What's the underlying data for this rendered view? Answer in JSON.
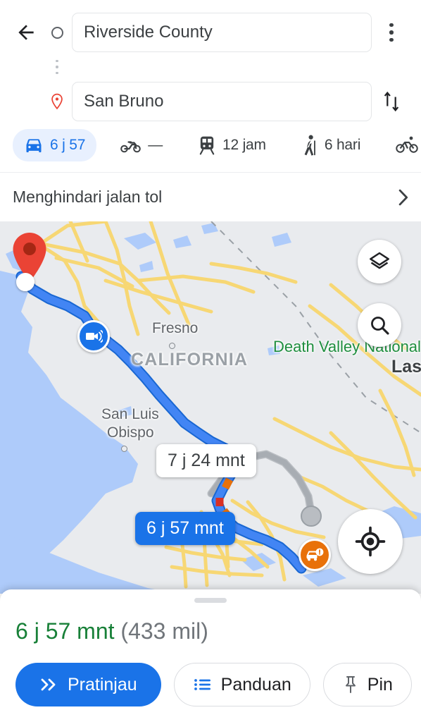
{
  "header": {
    "back_icon": "arrow-left-icon",
    "origin": {
      "value": "Riverside County",
      "icon": "origin-circle-icon"
    },
    "destination": {
      "value": "San Bruno",
      "icon": "destination-pin-icon"
    },
    "overflow_icon": "more-vert-icon",
    "swap_icon": "swap-vertical-icon"
  },
  "modes": [
    {
      "id": "driving",
      "icon": "car-icon",
      "label": "6 j 57",
      "active": true
    },
    {
      "id": "motorcycle",
      "icon": "motorcycle-icon",
      "label": "—",
      "active": false
    },
    {
      "id": "transit",
      "icon": "train-icon",
      "label": "12 jam",
      "active": false
    },
    {
      "id": "walking",
      "icon": "walk-icon",
      "label": "6 hari",
      "active": false
    },
    {
      "id": "cycling",
      "icon": "bicycle-icon",
      "label": "",
      "active": false
    }
  ],
  "options": {
    "label": "Menghindari jalan tol",
    "chevron_icon": "chevron-right-icon"
  },
  "map": {
    "labels": [
      {
        "id": "fresno",
        "text": "Fresno",
        "kind": "city"
      },
      {
        "id": "california",
        "text": "CALIFORNIA",
        "kind": "state"
      },
      {
        "id": "san-luis-1",
        "text": "San Luis",
        "kind": "city"
      },
      {
        "id": "san-luis-2",
        "text": "Obispo",
        "kind": "city"
      },
      {
        "id": "death-valley",
        "text": "Death Valley National Park",
        "kind": "park"
      },
      {
        "id": "las-vegas",
        "text": "Las",
        "kind": "city-big"
      }
    ],
    "route_chips": [
      {
        "id": "alt-route",
        "label": "7 j 24 mnt",
        "style": "alt"
      },
      {
        "id": "main-route",
        "label": "6 j 57 mnt",
        "style": "main"
      }
    ],
    "controls": [
      {
        "id": "layers",
        "icon": "layers-icon"
      },
      {
        "id": "search",
        "icon": "search-icon"
      },
      {
        "id": "my-location",
        "icon": "my-location-icon"
      }
    ],
    "markers": [
      {
        "id": "speed-camera",
        "icon": "speed-camera-icon",
        "color": "#1a73e8"
      },
      {
        "id": "traffic-incident",
        "icon": "traffic-incident-icon",
        "color": "#e8710a"
      }
    ],
    "colors": {
      "land": "#e9ebee",
      "water": "#aecbfa",
      "road": "#f6d26a",
      "route_main": "#4285f4",
      "route_alt": "#9aa0a6",
      "pin": "#ea4335"
    }
  },
  "sheet": {
    "handle": "drag-handle",
    "duration": "6 j 57 mnt",
    "distance": "(433 mil)",
    "buttons": [
      {
        "id": "preview",
        "label": "Pratinjau",
        "icon": "double-chevron-right-icon",
        "style": "primary"
      },
      {
        "id": "steps",
        "label": "Panduan",
        "icon": "list-icon",
        "style": "outline"
      },
      {
        "id": "pin",
        "label": "Pin",
        "icon": "pushpin-icon",
        "style": "outline"
      }
    ]
  }
}
